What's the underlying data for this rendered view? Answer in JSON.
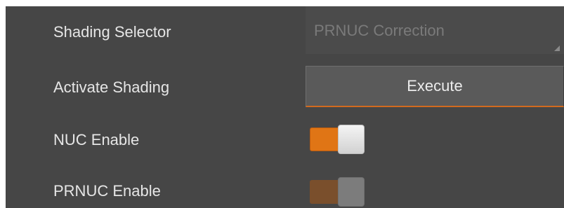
{
  "colors": {
    "panel_background": "#464646",
    "accent_orange": "#e07515",
    "label_text": "#e6e6e6",
    "disabled_text": "#7a7a7a"
  },
  "rows": {
    "shading_selector": {
      "label": "Shading Selector",
      "value": "PRNUC Correction",
      "enabled": false
    },
    "activate_shading": {
      "label": "Activate Shading",
      "button_label": "Execute"
    },
    "nuc_enable": {
      "label": "NUC Enable",
      "checked": true,
      "enabled": true
    },
    "prnuc_enable": {
      "label": "PRNUC Enable",
      "checked": true,
      "enabled": false
    }
  }
}
